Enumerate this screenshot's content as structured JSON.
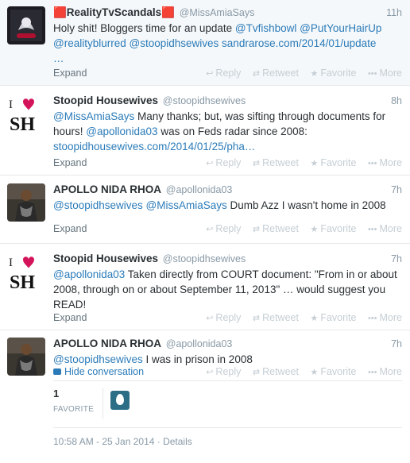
{
  "tweets": [
    {
      "fullname": "🟥RealityTvScandals🟥",
      "username": "@MissAmiaSays",
      "time": "11h",
      "text": {
        "t0": "Holy shit! Bloggers time for an update ",
        "l0": "@Tvfishbowl",
        "t1": " ",
        "l1": "@PutYourHairUp",
        "l2": "@realityblurred",
        "t2": " ",
        "l3": "@stoopidhsewives",
        "t3": "  ",
        "l4": "sandrarose.com/2014/01/update",
        "l5": "…"
      },
      "action_left": "Expand"
    },
    {
      "fullname": "Stoopid Housewives",
      "username": "@stoopidhsewives",
      "time": "8h",
      "text": {
        "l0": "@MissAmiaSays",
        "t0": " Many thanks; but, was sifting through documents for hours!  ",
        "l1": "@apollonida03",
        "t1": " was on Feds radar since 2008: ",
        "l2": "stoopidhousewives.com/2014/01/25/pha…"
      },
      "action_left": "Expand"
    },
    {
      "fullname": "APOLLO NIDA RHOA",
      "username": "@apollonida03",
      "time": "7h",
      "text": {
        "l0": "@stoopidhsewives",
        "t0": " ",
        "l1": "@MissAmiaSays",
        "t1": " Dumb Azz I wasn't home in 2008"
      },
      "action_left": "Expand"
    },
    {
      "fullname": "Stoopid Housewives",
      "username": "@stoopidhsewives",
      "time": "7h",
      "text": {
        "l0": "@apollonida03",
        "t0": " Taken directly from COURT document: \"From in or about 2008, through on or about September 11, 2013\" … would suggest you READ!"
      },
      "action_left": "Expand"
    },
    {
      "fullname": "APOLLO NIDA RHOA",
      "username": "@apollonida03",
      "time": "7h",
      "text": {
        "l0": "@stoopidhsewives",
        "t0": "  I was in prison in 2008"
      },
      "action_left": "Hide conversation"
    }
  ],
  "actions": {
    "reply": "Reply",
    "retweet": "Retweet",
    "favorite": "Favorite",
    "more": "More"
  },
  "stats": {
    "favorite_count": "1",
    "favorite_label": "FAVORITE"
  },
  "meta": "10:58 AM - 25 Jan 2014 · Details",
  "colors": {
    "link": "#2b7bb9",
    "muted": "#8899a6",
    "selected_bg": "#f5f8fa"
  }
}
